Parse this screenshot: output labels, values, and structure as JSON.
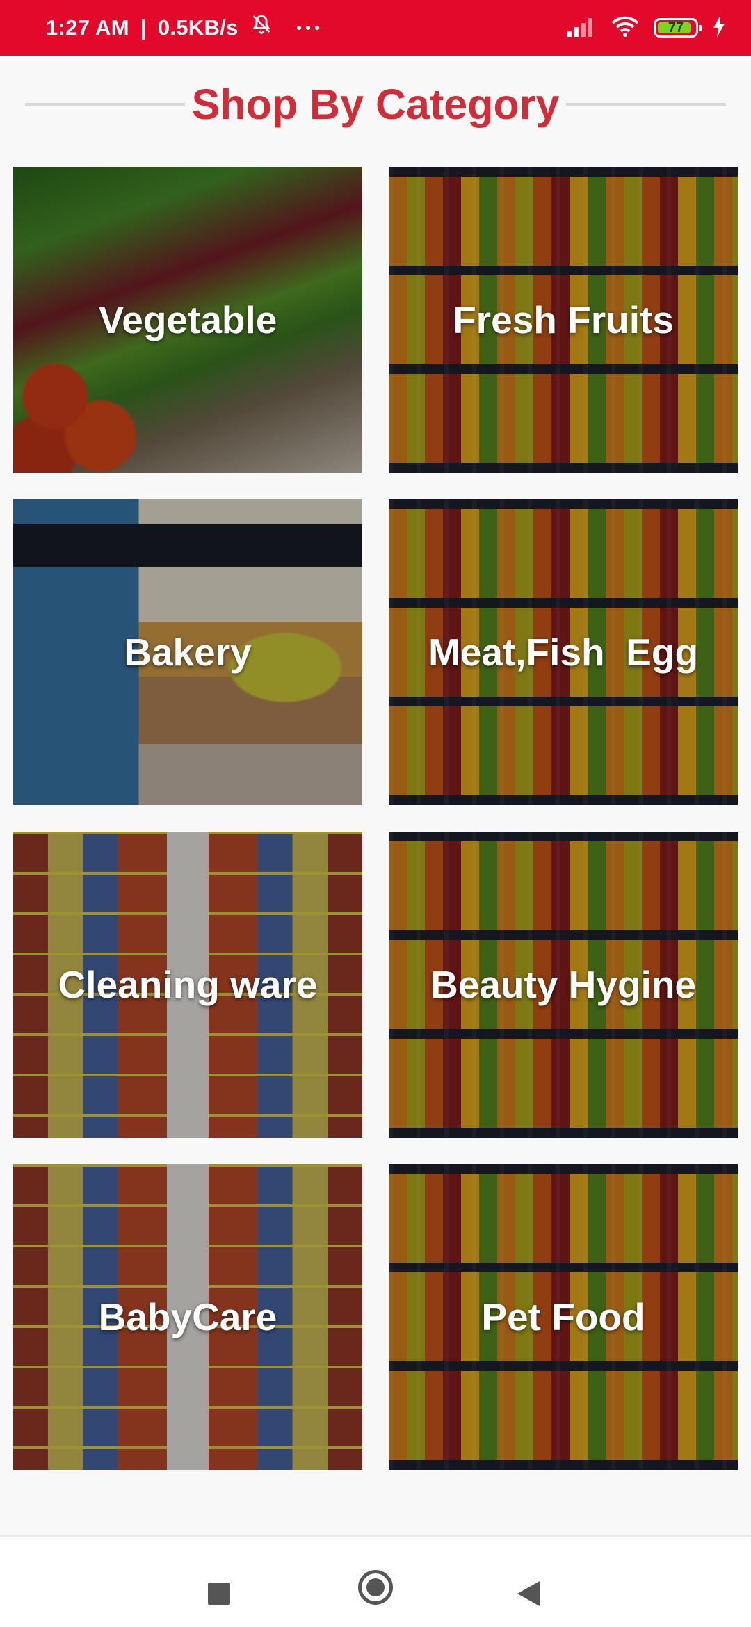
{
  "status_bar": {
    "time": "1:27 AM",
    "separator": "|",
    "net_speed": "0.5KB/s",
    "battery_percent": "77",
    "icons": [
      "mute-bell-icon",
      "more-dots-icon",
      "signal-icon",
      "wifi-icon",
      "battery-icon",
      "charging-bolt-icon"
    ],
    "color": "#e3092a"
  },
  "page": {
    "title": "Shop By Category",
    "title_color": "#cf2e38"
  },
  "categories": [
    {
      "label": "Vegetable",
      "image": "vegetables"
    },
    {
      "label": "Fresh Fruits",
      "image": "fruit-cups"
    },
    {
      "label": "Bakery",
      "image": "grocery-store"
    },
    {
      "label": "Meat,Fish  Egg",
      "image": "fruit-cups"
    },
    {
      "label": "Cleaning ware",
      "image": "store-aisle"
    },
    {
      "label": "Beauty Hygine",
      "image": "fruit-cups"
    },
    {
      "label": "BabyCare",
      "image": "store-aisle"
    },
    {
      "label": "Pet Food",
      "image": "fruit-cups"
    }
  ],
  "nav_bar": {
    "buttons": [
      "recents-square-icon",
      "home-circle-icon",
      "back-triangle-icon"
    ]
  }
}
